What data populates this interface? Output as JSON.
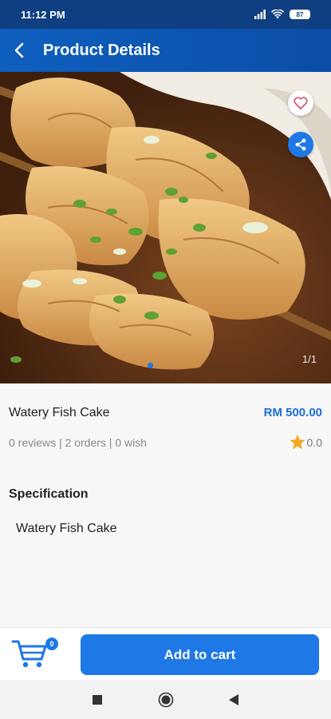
{
  "status_bar": {
    "time": "11:12 PM",
    "battery": "87",
    "icons": [
      "signal-icon",
      "wifi-icon",
      "battery-icon"
    ]
  },
  "header": {
    "title": "Product Details",
    "back_icon": "back-arrow-icon"
  },
  "gallery": {
    "counter": "1/1",
    "favorite_icon": "heart-outline-icon",
    "share_icon": "share-icon"
  },
  "product": {
    "name": "Watery Fish Cake",
    "price": "RM 500.00",
    "stats": "0 reviews | 2 orders | 0 wish",
    "rating": "0.0",
    "specification_heading": "Specification",
    "specification_value": "Watery Fish Cake"
  },
  "bottom_bar": {
    "cart_count": "0",
    "add_to_cart_label": "Add to cart"
  },
  "colors": {
    "app_bar": "#0f5fbe",
    "accent": "#1e78e6",
    "price": "#1a6fd6",
    "star": "#f5a623"
  }
}
